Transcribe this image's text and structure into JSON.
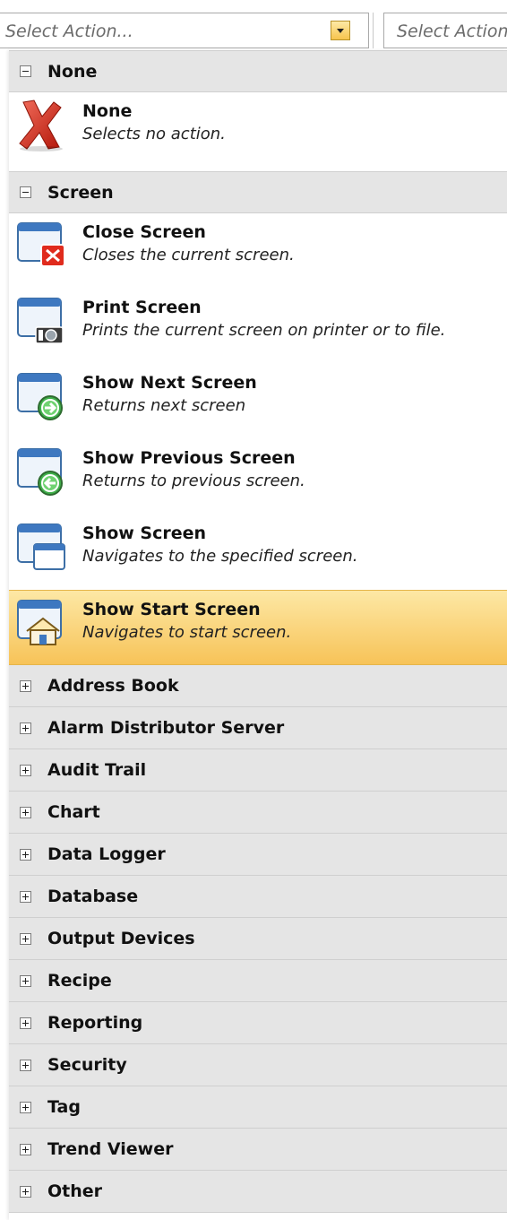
{
  "combo": {
    "placeholder": "Select Action...",
    "second_placeholder": "Select Action"
  },
  "groups": [
    {
      "name": "None",
      "expanded": true,
      "items": [
        {
          "title": "None",
          "description": "Selects no action.",
          "icon": "red-x-icon"
        }
      ]
    },
    {
      "name": "Screen",
      "expanded": true,
      "items": [
        {
          "title": "Close Screen",
          "description": "Closes the current screen.",
          "icon": "close-screen-icon"
        },
        {
          "title": "Print Screen",
          "description": "Prints the current screen on printer or to file.",
          "icon": "print-screen-icon"
        },
        {
          "title": "Show Next Screen",
          "description": "Returns next screen",
          "icon": "next-screen-icon"
        },
        {
          "title": "Show Previous Screen",
          "description": "Returns to previous screen.",
          "icon": "previous-screen-icon"
        },
        {
          "title": "Show Screen",
          "description": "Navigates to the specified screen.",
          "icon": "show-screen-icon"
        },
        {
          "title": "Show Start Screen",
          "description": "Navigates to start screen.",
          "icon": "start-screen-icon",
          "selected": true
        }
      ]
    }
  ],
  "collapsed_groups": [
    "Address Book",
    "Alarm Distributor Server",
    "Audit Trail",
    "Chart",
    "Data Logger",
    "Database",
    "Output Devices",
    "Recipe",
    "Reporting",
    "Security",
    "Tag",
    "Trend Viewer",
    "Other"
  ],
  "colors": {
    "highlight_top": "#fde8a5",
    "highlight_bottom": "#f7c358",
    "group_header_bg": "#e5e5e5"
  }
}
